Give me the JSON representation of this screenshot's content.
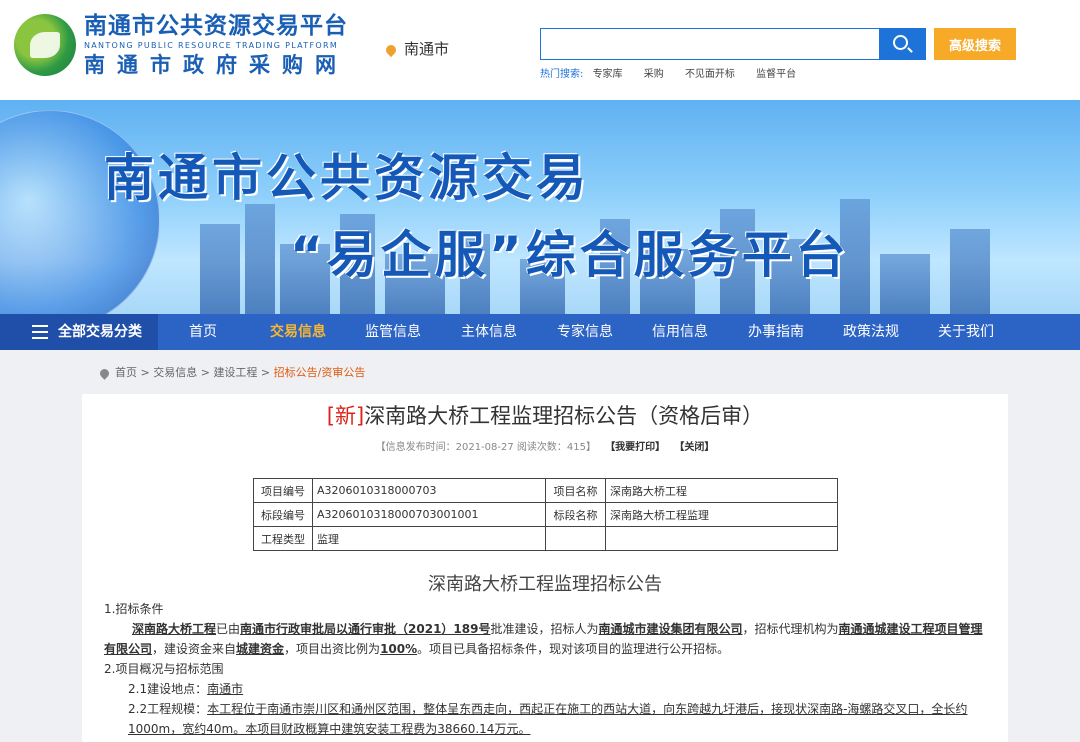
{
  "header": {
    "logo_cn": "南通市公共资源交易平台",
    "logo_en": "NANTONG PUBLIC RESOURCE TRADING PLATFORM",
    "logo_cn2": "南通市政府采购网",
    "location": "南通市",
    "search_placeholder": "",
    "advanced_search": "高级搜索",
    "hot_label": "热门搜索:",
    "hot_items": [
      "专家库",
      "采购",
      "不见面开标",
      "监督平台"
    ]
  },
  "banner": {
    "line1": "南通市公共资源交易",
    "line2": "“易企服”综合服务平台"
  },
  "nav": {
    "all": "全部交易分类",
    "items": [
      "首页",
      "交易信息",
      "监管信息",
      "主体信息",
      "专家信息",
      "信用信息",
      "办事指南",
      "政策法规",
      "关于我们"
    ],
    "active": "交易信息"
  },
  "breadcrumb": {
    "items": [
      "首页",
      "交易信息",
      "建设工程"
    ],
    "current": "招标公告/资审公告"
  },
  "article": {
    "tag": "[新]",
    "title": "深南路大桥工程监理招标公告（资格后审）",
    "meta": "【信息发布时间：2021-08-27 阅读次数：415】",
    "print": "【我要打印】",
    "close": "【关闭】",
    "table": [
      [
        "项目编号",
        "A3206010318000703",
        "项目名称",
        "深南路大桥工程"
      ],
      [
        "标段编号",
        "A3206010318000703001001",
        "标段名称",
        "深南路大桥工程监理"
      ],
      [
        "工程类型",
        "监理",
        "",
        ""
      ]
    ],
    "doc_title": "深南路大桥工程监理招标公告",
    "s1_head": "1.招标条件",
    "s1_a": "深南路大桥工程",
    "s1_b": "已由",
    "s1_c": "南通市行政审批局以通行审批（2021）189号",
    "s1_d": "批准建设，招标人为",
    "s1_e": "南通城市建设集团有限公司",
    "s1_f": "，招标代理机构为",
    "s1_g": "南通通城建设工程项目管理有限公司",
    "s1_h": "，建设资金来自",
    "s1_i": "城建资金",
    "s1_j": "，项目出资比例为",
    "s1_k": "100%",
    "s1_l": "。项目已具备招标条件，现对该项目的监理进行公开招标。",
    "s2_head": "2.项目概况与招标范围",
    "s2_1_label": "2.1建设地点：",
    "s2_1_value": "南通市",
    "s2_2_label": "2.2工程规模：",
    "s2_2_value": "本工程位于南通市崇川区和通州区范围，整体呈东西走向，西起正在施工的西站大道，向东跨越九圩港后，接现状深南路-海螺路交叉口，全长约1000m，宽约40m。本项目财政概算中建筑安装工程费为38660.14万元。"
  }
}
